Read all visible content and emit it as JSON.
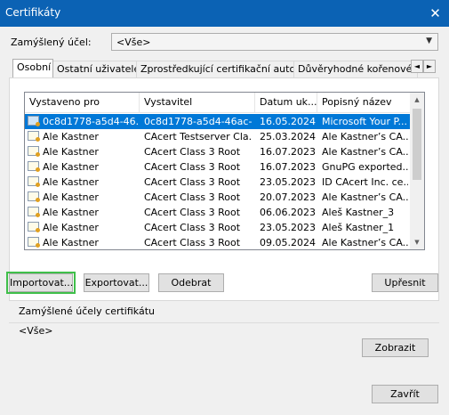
{
  "window": {
    "title": "Certifikáty",
    "close_symbol": "✕"
  },
  "purpose": {
    "label": "Zamýšlený účel:",
    "value": "<Vše>"
  },
  "tabs": [
    "Osobní",
    "Ostatní uživatelé",
    "Zprostředkující certifikační autority",
    "Důvěryhodné kořenové certifikační autority"
  ],
  "tab_scroll": {
    "left": "◄",
    "right": "►"
  },
  "table": {
    "columns": [
      "Vystaveno pro",
      "Vystavitel",
      "Datum uk...",
      "Popisný název"
    ],
    "rows": [
      [
        "0c8d1778-a5d4-46...",
        "0c8d1778-a5d4-46ac-...",
        "16.05.2024",
        "Microsoft Your P..."
      ],
      [
        "Ale Kastner",
        "CAcert Testserver Cla...",
        "25.03.2024",
        "Ale Kastner’s CA..."
      ],
      [
        "Ale Kastner",
        "CAcert Class 3 Root",
        "16.07.2023",
        "Ale Kastner’s CA..."
      ],
      [
        "Ale Kastner",
        "CAcert Class 3 Root",
        "16.07.2023",
        "GnuPG exported..."
      ],
      [
        "Ale Kastner",
        "CAcert Class 3 Root",
        "23.05.2023",
        "ID CAcert Inc. ce..."
      ],
      [
        "Ale Kastner",
        "CAcert Class 3 Root",
        "20.07.2023",
        "Ale Kastner’s CA..."
      ],
      [
        "Ale Kastner",
        "CAcert Class 3 Root",
        "06.06.2023",
        "Aleš Kastner_3"
      ],
      [
        "Ale Kastner",
        "CAcert Class 3 Root",
        "23.05.2023",
        "Aleš Kastner_1"
      ],
      [
        "Ale Kastner",
        "CAcert Class 3 Root",
        "09.05.2024",
        "Ale Kastner’s CA..."
      ]
    ],
    "selected_row": 0
  },
  "buttons": {
    "import": "Importovat...",
    "export": "Exportovat...",
    "remove": "Odebrat",
    "advanced": "Upřesnit",
    "view": "Zobrazit",
    "close": "Zavřít"
  },
  "purposes_group": {
    "title": "Zamýšlené účely certifikátu",
    "value": "<Vše>"
  }
}
